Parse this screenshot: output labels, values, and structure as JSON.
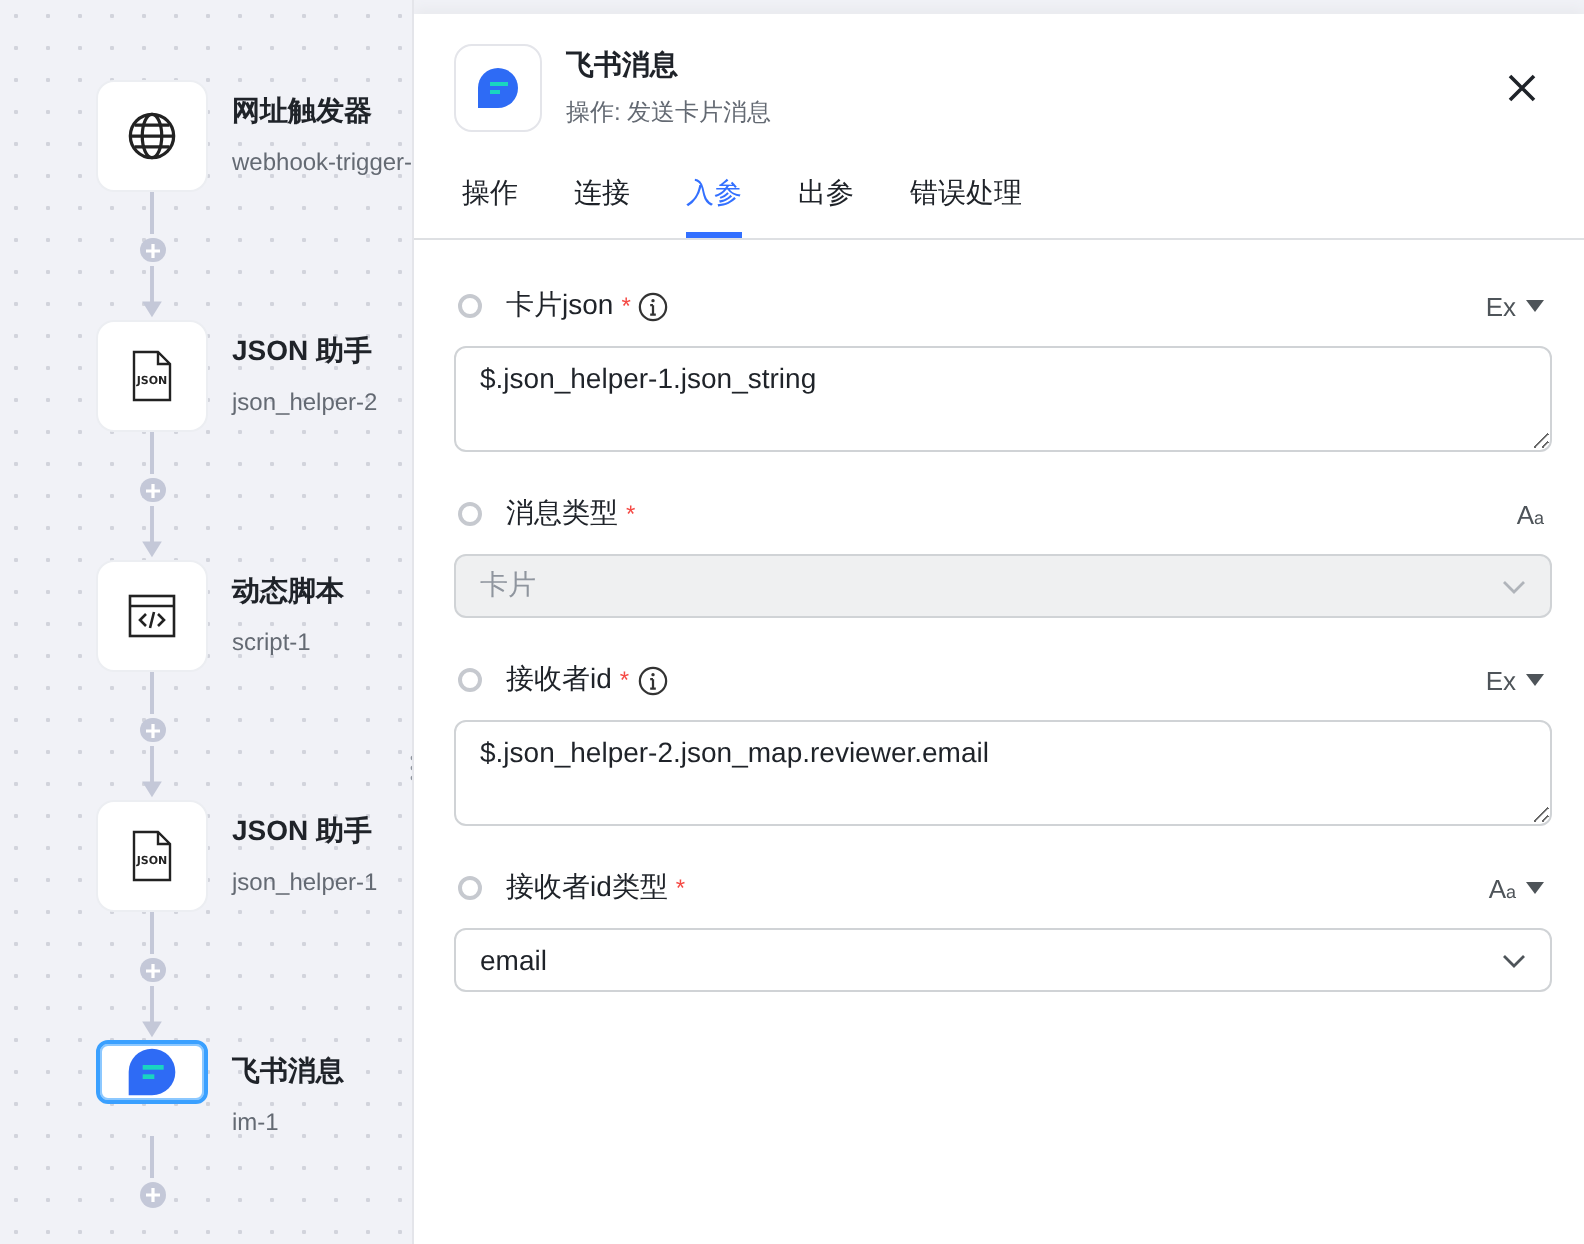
{
  "flow": {
    "nodes": [
      {
        "kind": "globe",
        "name": "网址触发器",
        "id_label": "webhook-trigger-",
        "selected": false
      },
      {
        "kind": "json",
        "icon_text": "JSON",
        "name": "JSON 助手",
        "id_label": "json_helper-2",
        "selected": false
      },
      {
        "kind": "code",
        "name": "动态脚本",
        "id_label": "script-1",
        "selected": false
      },
      {
        "kind": "json",
        "icon_text": "JSON",
        "name": "JSON 助手",
        "id_label": "json_helper-1",
        "selected": false
      },
      {
        "kind": "message",
        "name": "飞书消息",
        "id_label": "im-1",
        "selected": true
      }
    ]
  },
  "panel": {
    "title": "飞书消息",
    "subtitle": "操作: 发送卡片消息",
    "tabs": [
      {
        "label": "操作",
        "selected": false
      },
      {
        "label": "连接",
        "selected": false
      },
      {
        "label": "入参",
        "selected": true
      },
      {
        "label": "出参",
        "selected": false
      },
      {
        "label": "错误处理",
        "selected": false
      }
    ],
    "fields": [
      {
        "kind": "textarea",
        "checked": false,
        "label": "卡片json",
        "required_mark": "*",
        "info": true,
        "mode": "Ex",
        "mode_menu": true,
        "value": "$.json_helper-1.json_string"
      },
      {
        "kind": "select",
        "checked": false,
        "label": "消息类型",
        "required_mark": "*",
        "info": false,
        "mode": "A$_{a}$",
        "mode_menu": false,
        "value": "卡片",
        "disabled": true
      },
      {
        "kind": "textarea",
        "checked": false,
        "label": "接收者id",
        "required_mark": "*",
        "info": true,
        "mode": "Ex",
        "mode_menu": true,
        "value": "$.json_helper-2.json_map.reviewer.email"
      },
      {
        "kind": "select",
        "checked": false,
        "label": "接收者id类型",
        "required_mark": "*",
        "info": false,
        "mode": "A$_{a}$",
        "mode_menu": true,
        "value": "email",
        "disabled": false
      }
    ]
  }
}
